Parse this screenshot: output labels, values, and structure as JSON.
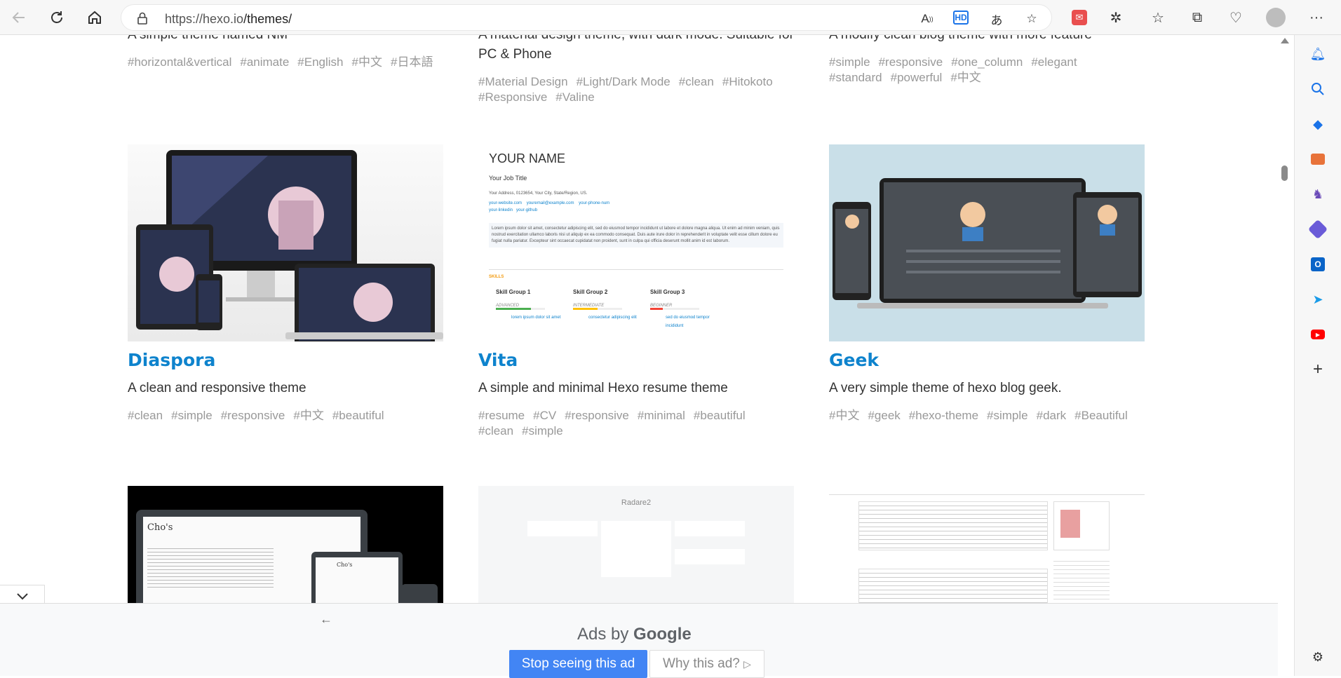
{
  "browser": {
    "url_domain": "https://hexo.io",
    "url_path": "/themes/"
  },
  "themes_top": [
    {
      "desc": "A simple theme named NM",
      "tags": [
        "#horizontal&vertical",
        "#animate",
        "#English",
        "#中文",
        "#日本語"
      ]
    },
    {
      "desc": "A material design theme, with dark mode. Suitable for PC & Phone",
      "tags": [
        "#Material Design",
        "#Light/Dark Mode",
        "#clean",
        "#Hitokoto",
        "#Responsive",
        "#Valine"
      ]
    },
    {
      "desc": "A modify clean blog theme with more feature",
      "tags": [
        "#simple",
        "#responsive",
        "#one_column",
        "#elegant",
        "#standard",
        "#powerful",
        "#中文"
      ]
    }
  ],
  "themes": [
    {
      "name": "Diaspora",
      "desc": "A clean and responsive theme",
      "tags": [
        "#clean",
        "#simple",
        "#responsive",
        "#中文",
        "#beautiful"
      ]
    },
    {
      "name": "Vita",
      "desc": "A simple and minimal Hexo resume theme",
      "tags": [
        "#resume",
        "#CV",
        "#responsive",
        "#minimal",
        "#beautiful",
        "#clean",
        "#simple"
      ]
    },
    {
      "name": "Geek",
      "desc": "A very simple theme of hexo blog geek.",
      "tags": [
        "#中文",
        "#geek",
        "#hexo-theme",
        "#simple",
        "#dark",
        "#Beautiful"
      ]
    }
  ],
  "vita_preview": {
    "name": "YOUR NAME",
    "job": "Your Job Title",
    "address": "Your Address, 0123654, Your City, State/Region, US.",
    "website": "your-website.com",
    "email": "youremail@example.com",
    "phone": "your-phone-num",
    "linkedin": "your-linkedin",
    "github": "your-github",
    "lorem": "Lorem ipsum dolor sit amet, consectetur adipiscing elit, sed do eiusmod tempor incididunt ut labore et dolore magna aliqua. Ut enim ad minim veniam, quis nostrud exercitation ullamco laboris nisi ut aliquip ex ea commodo consequat. Duis aute irure dolor in reprehenderit in voluptate velit esse cillum dolore eu fugiat nulla pariatur. Excepteur sint occaecat cupidatat non proident, sunt in culpa qui officia deserunt mollit anim id est laborum.",
    "skills_label": "SKILLS",
    "groups": [
      {
        "title": "Skill Group 1",
        "level": "ADVANCED",
        "color": "#4caf50",
        "chips": [
          "lorem",
          "ipsum",
          "dolor",
          "sit",
          "amet"
        ]
      },
      {
        "title": "Skill Group 2",
        "level": "INTERMEDIATE",
        "color": "#ffc107",
        "chips": [
          "consectetur",
          "adipiscing",
          "elit"
        ]
      },
      {
        "title": "Skill Group 3",
        "level": "BEGINNER",
        "color": "#f44336",
        "chips": [
          "sed do",
          "eiusmod",
          "tempor",
          "incididunt"
        ]
      }
    ]
  },
  "bottom_previews": {
    "chos_title": "Cho's",
    "radare_title": "Radare2"
  },
  "ad": {
    "ads_by": "Ads by",
    "google": "Google",
    "stop": "Stop seeing this ad",
    "why": "Why this ad?"
  },
  "colors": {
    "link": "#0e83cd",
    "ad_button": "#4285f4"
  }
}
